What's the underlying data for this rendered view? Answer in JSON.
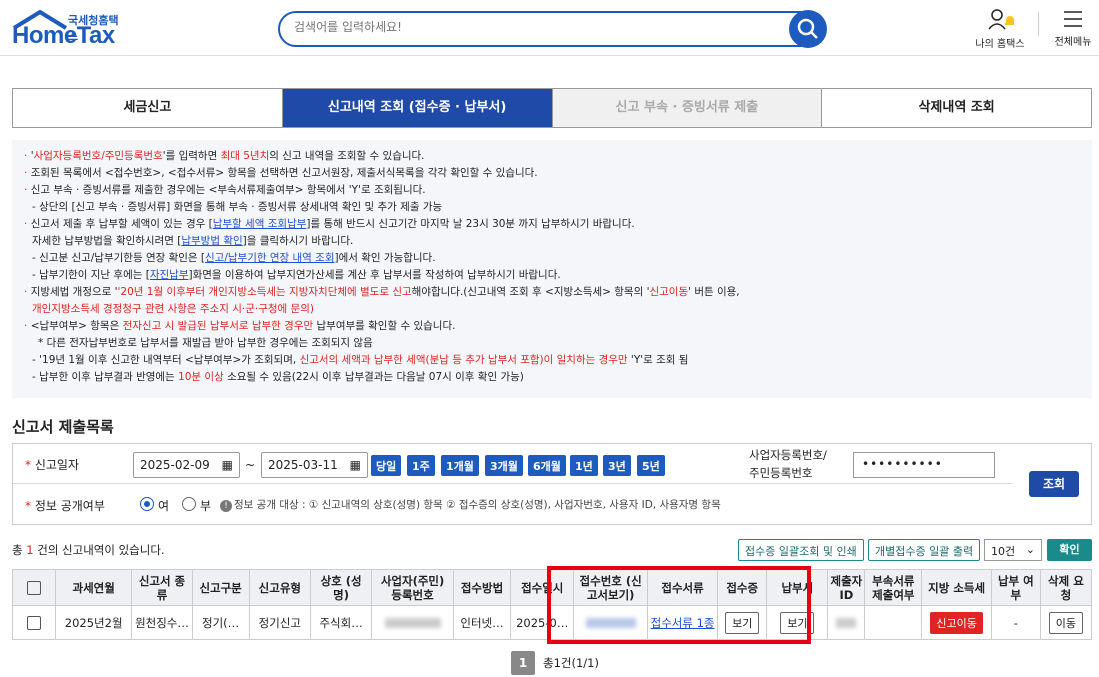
{
  "header": {
    "logo_ko": "국세청홈택스",
    "logo_en": "HomeTax",
    "search_placeholder": "검색어를 입력하세요!",
    "my_hometax": "나의 홈택스",
    "full_menu": "전체메뉴"
  },
  "tabs": [
    {
      "label": "세금신고",
      "state": "normal"
    },
    {
      "label": "신고내역 조회 (접수증 · 납부서)",
      "state": "active"
    },
    {
      "label": "신고 부속 · 증빙서류 제출",
      "state": "disabled"
    },
    {
      "label": "삭제내역 조회",
      "state": "normal"
    }
  ],
  "notice": {
    "l1a": "'",
    "l1b": "사업자등록번호/주민등록번호",
    "l1c": "'를 입력하면 ",
    "l1d": "최대 5년치",
    "l1e": "의 신고 내역을 조회할 수 있습니다.",
    "l2": "조회된 목록에서 <접수번호>, <접수서류> 항목을 선택하면 신고서원장, 제출서식목록을 각각 확인할 수 있습니다.",
    "l3": "신고 부속 · 증빙서류를 제출한 경우에는 <부속서류제출여부> 항목에서 'Y'로 조회됩니다.",
    "l4": "- 상단의 [신고 부속 · 증빙서류] 화면을 통해 부속 · 증빙서류 상세내역 확인 및 추가 제출 가능",
    "l5a": "신고서 제출 후 납부할 세액이 있는 경우 [",
    "l5b": "납부할 세액 조회납부",
    "l5c": "]를 통해 반드시 신고기간 마지막 날 23시 30분 까지 납부하시기 바랍니다.",
    "l6a": "자세한 납부방법을 확인하시려면 [",
    "l6b": "납부방법 확인",
    "l6c": "]을 클릭하시기 바랍니다.",
    "l7a": "- 신고분 신고/납부기한등 연장 확인은 [",
    "l7b": "신고/납부기한 연장 내역 조회",
    "l7c": "]에서 확인 가능합니다.",
    "l8a": "- 납부기한이 지난 후에는 [",
    "l8b": "자진납부",
    "l8c": "]화면을 이용하여 납부지연가산세를 계산 후 납부서를 작성하여 납부하시기 바랍니다.",
    "l9a": "지방세법 개정으로 '",
    "l9b": "'20년 1월 이후부터 개인지방소득세는 지방자치단체에 별도로 신고",
    "l9c": "해야합니다.(신고내역 조회 후 <지방소득세> 항목의 '",
    "l9d": "신고이동",
    "l9e": "' 버튼 이용,",
    "l10": "개인지방소득세 경정청구 관련 사항은 주소지 시·군·구청에 문의)",
    "l11a": "<납부여부> 항목은 ",
    "l11b": "전자신고 시 발급된 납부서로 납부한 경우만",
    "l11c": " 납부여부를 확인할 수 있습니다.",
    "l12": "* 다른 전자납부번호로 납부서를 재발급 받아 납부한 경우에는 조회되지 않음",
    "l13a": "- '19년 1월 이후 신고한 내역부터 <납부여부>가 조회되며, ",
    "l13b": "신고서의 세액과 납부한 세액(분납 등 추가 납부서 포함)이 일치하는 경우만",
    "l13c": " 'Y'로 조회 됨",
    "l14a": "- 납부한 이후 납부결과 반영에는 ",
    "l14b": "10분 이상",
    "l14c": " 소요될 수 있음(22시 이후 납부결과는 다음날 07시 이후 확인 가능)"
  },
  "section_title": "신고서 제출목록",
  "form": {
    "date_label": "신고일자",
    "date_from": "2025-02-09",
    "date_sep": "~",
    "date_to": "2025-03-11",
    "periods": [
      "당일",
      "1주",
      "1개월",
      "3개월",
      "6개월",
      "1년",
      "3년",
      "5년"
    ],
    "biz_label_1": "사업자등록번호/",
    "biz_label_2": "주민등록번호",
    "biz_value": "••••••••••",
    "query_button": "조회",
    "info_label": "정보 공개여부",
    "radio_yes": "여",
    "radio_no": "부",
    "info_desc": "정보 공개 대상 : ① 신고내역의 상호(성명) 항목 ② 접수증의 상호(성명), 사업자번호, 사용자 ID, 사용자명 항목"
  },
  "list": {
    "count_prefix": "총 ",
    "count_value": "1",
    "count_suffix": " 건의 신고내역이 있습니다.",
    "btn_bulk_receipt": "접수증 일괄조회 및 인쇄",
    "btn_bulk_print": "개별접수증 일괄 출력",
    "page_size": "10건",
    "confirm": "확인"
  },
  "table": {
    "headers": [
      "과세연월",
      "신고서 종류",
      "신고구분",
      "신고유형",
      "상호 (성명)",
      "사업자(주민) 등록번호",
      "접수방법",
      "접수일시",
      "접수번호 (신고서보기)",
      "접수서류",
      "접수증",
      "납부서",
      "제출자 ID",
      "부속서류 제출여부",
      "지방 소득세",
      "납부 여부",
      "삭제 요청"
    ],
    "rows": [
      {
        "period": "2025년2월",
        "kind": "원천징수…",
        "division": "정기(…",
        "type": "정기신고",
        "name": "주식회…",
        "method": "인터넷…",
        "datetime": "2025-0…",
        "docs": "접수서류 1종",
        "receipt_btn": "보기",
        "payment_btn": "보기",
        "attach": "",
        "local_tax_btn": "신고이동",
        "paid": "-",
        "delete_btn": "이동"
      }
    ]
  },
  "pagination": {
    "current": "1",
    "summary": "총1건(1/1)"
  }
}
